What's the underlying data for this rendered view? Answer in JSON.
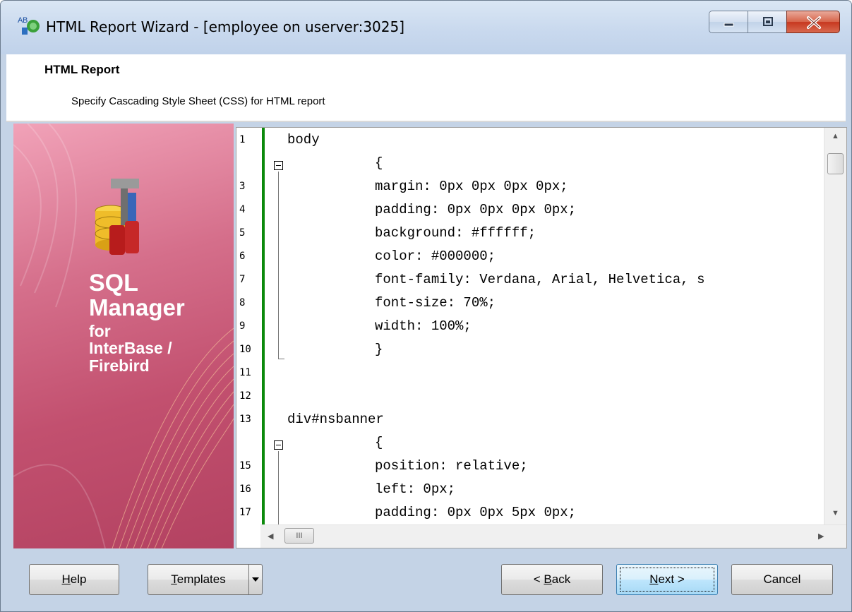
{
  "window": {
    "title": "HTML Report Wizard - [employee on userver:3025]"
  },
  "header": {
    "title": "HTML Report",
    "subtitle": "Specify Cascading Style Sheet (CSS) for HTML report"
  },
  "banner": {
    "line1": "SQL",
    "line2": "Manager",
    "line3": "for",
    "line4": "InterBase /",
    "line5": "Firebird"
  },
  "editor": {
    "lines": [
      {
        "num": "1",
        "text": "body"
      },
      {
        "num": "",
        "text": "{"
      },
      {
        "num": "3",
        "text": "margin: 0px 0px 0px 0px;"
      },
      {
        "num": "4",
        "text": "padding: 0px 0px 0px 0px;"
      },
      {
        "num": "5",
        "text": "background: #ffffff;"
      },
      {
        "num": "6",
        "text": "color: #000000;"
      },
      {
        "num": "7",
        "text": "font-family: Verdana, Arial, Helvetica, s"
      },
      {
        "num": "8",
        "text": "font-size: 70%;"
      },
      {
        "num": "9",
        "text": "width: 100%;"
      },
      {
        "num": "10",
        "text": "}"
      },
      {
        "num": "11",
        "text": ""
      },
      {
        "num": "12",
        "text": ""
      },
      {
        "num": "13",
        "text": "div#nsbanner"
      },
      {
        "num": "",
        "text": "{"
      },
      {
        "num": "15",
        "text": "position: relative;"
      },
      {
        "num": "16",
        "text": "left: 0px;"
      },
      {
        "num": "17",
        "text": "padding: 0px 0px 5px 0px;"
      }
    ],
    "hscroll_thumb": "III"
  },
  "footer": {
    "help": "Help",
    "help_accel": "H",
    "help_rest": "elp",
    "templates_accel": "T",
    "templates_rest": "emplates",
    "back_pre": "< ",
    "back_accel": "B",
    "back_rest": "ack",
    "next_accel": "N",
    "next_rest": "ext >",
    "cancel": "Cancel"
  }
}
